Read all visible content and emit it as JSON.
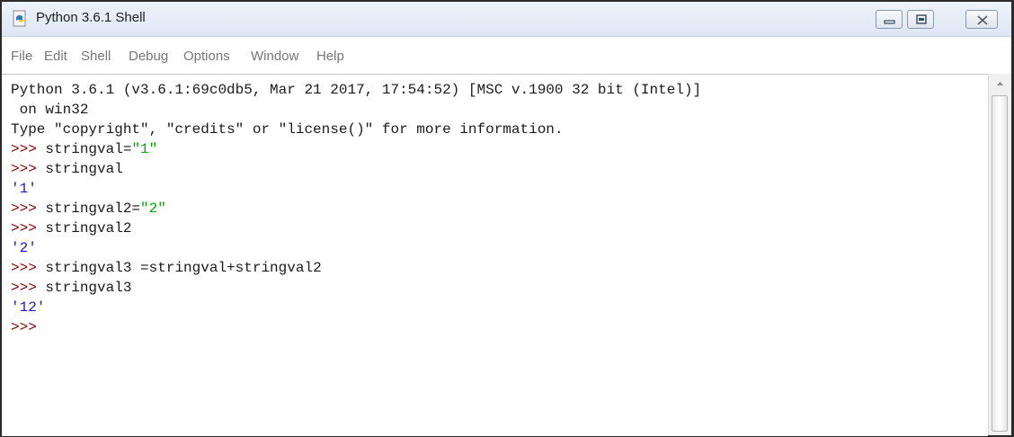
{
  "window": {
    "title": "Python 3.6.1 Shell",
    "icons": [
      "python-idle-icon",
      "minimize-icon",
      "maximize-icon",
      "close-icon"
    ]
  },
  "menu": [
    "File",
    "Edit",
    "Shell",
    "Debug",
    "Options",
    "Window",
    "Help"
  ],
  "shell": {
    "banner1": "Python 3.6.1 (v3.6.1:69c0db5, Mar 21 2017, 17:54:52) [MSC v.1900 32 bit (Intel)]",
    "banner2": " on win32",
    "banner3": "Type \"copyright\", \"credits\" or \"license()\" for more information.",
    "prompt": ">>>",
    "lines": [
      {
        "code": " stringval=",
        "str": "\"1\""
      },
      {
        "code": " stringval"
      },
      {
        "out": "'1'"
      },
      {
        "code": " stringval2=",
        "str": "\"2\""
      },
      {
        "code": " stringval2"
      },
      {
        "out": "'2'"
      },
      {
        "code": " stringval3 =stringval+stringval2"
      },
      {
        "code": " stringval3"
      },
      {
        "out": "'12'"
      },
      {
        "prompt_only": true
      }
    ]
  },
  "colors": {
    "prompt": "#8b0000",
    "string": "#00aa00",
    "output": "#1a1ad8",
    "menu_text": "#777777"
  }
}
